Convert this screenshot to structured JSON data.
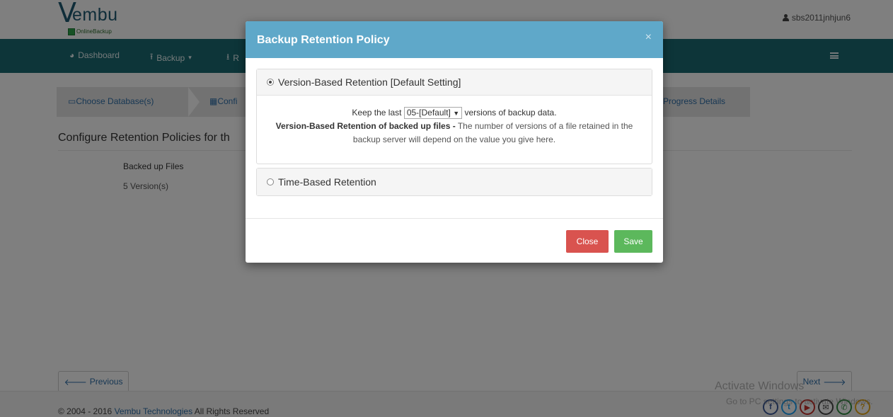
{
  "brand": {
    "name": "embu",
    "initial": "V",
    "sub": "OnlineBackup"
  },
  "user": {
    "name": "sbs2011jnhjun6",
    "icon": "user-icon"
  },
  "nav": [
    {
      "label": "Dashboard",
      "icon": "pie-chart-icon"
    },
    {
      "label": "Backup",
      "icon": "upload-icon"
    },
    {
      "label": "R",
      "icon": "download-icon"
    }
  ],
  "steps": [
    "Choose Database(s)",
    "Confi",
    "Progress Details"
  ],
  "page": {
    "section_title": "Configure Retention Policies for th",
    "backed_up_label": "Backed up Files",
    "backed_up_value": "5 Version(s)"
  },
  "buttons": {
    "previous": "Previous",
    "next": "Next"
  },
  "footer": {
    "copyright_prefix": "© 2004 - 2016 ",
    "company": "Vembu Technologies",
    "copyright_suffix": " All Rights Reserved"
  },
  "watermark": {
    "line1": "Activate Windows",
    "line2": "Go to PC settings to activate Windows."
  },
  "modal": {
    "title": "Backup Retention Policy",
    "close_glyph": "×",
    "option_version": "Version-Based Retention [Default Setting]",
    "keep_prefix": "Keep the last",
    "keep_select": "05-[Default]",
    "keep_suffix": "versions of backup data.",
    "desc_bold": "Version-Based Retention of backed up files -",
    "desc_text": " The number of versions of a file retained in the backup server will depend on the value you give here.",
    "option_time": "Time-Based Retention",
    "close_button": "Close",
    "save_button": "Save"
  },
  "colors": {
    "navbar": "#1b6b73",
    "modal_header": "#5fa8c9",
    "close": "#d9534f",
    "save": "#5cb85c"
  }
}
